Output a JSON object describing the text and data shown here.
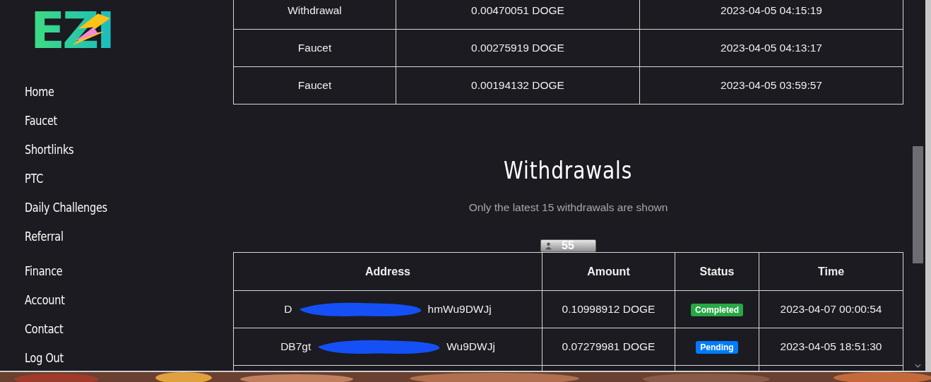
{
  "logo": {
    "text": "EZI"
  },
  "nav_groups": [
    {
      "items": [
        {
          "label": "Home"
        },
        {
          "label": "Faucet"
        },
        {
          "label": "Shortlinks"
        },
        {
          "label": "PTC"
        },
        {
          "label": "Daily Challenges"
        },
        {
          "label": "Referral"
        }
      ]
    },
    {
      "items": [
        {
          "label": "Finance"
        },
        {
          "label": "Account"
        },
        {
          "label": "Contact"
        },
        {
          "label": "Log Out"
        }
      ]
    }
  ],
  "history_table": {
    "rows": [
      {
        "type": "Withdrawal",
        "amount": "0.00470051 DOGE",
        "time": "2023-04-05 04:15:19"
      },
      {
        "type": "Faucet",
        "amount": "0.00275919 DOGE",
        "time": "2023-04-05 04:13:17"
      },
      {
        "type": "Faucet",
        "amount": "0.00194132 DOGE",
        "time": "2023-04-05 03:59:57"
      }
    ]
  },
  "withdrawals": {
    "title": "Withdrawals",
    "subtitle": "Only the latest 15 withdrawals are shown",
    "counter": "55",
    "columns": [
      "Address",
      "Amount",
      "Status",
      "Time"
    ],
    "rows": [
      {
        "address_start": "D",
        "address_end": "hmWu9DWJj",
        "amount": "0.10998912 DOGE",
        "status": "Completed",
        "color": "#28a745",
        "time": "2023-04-07 00:00:54"
      },
      {
        "address_start": "DB7gt",
        "address_end": "Wu9DWJj",
        "amount": "0.07279981 DOGE",
        "status": "Pending",
        "color": "#007bff",
        "time": "2023-04-05 18:51:30"
      }
    ]
  }
}
